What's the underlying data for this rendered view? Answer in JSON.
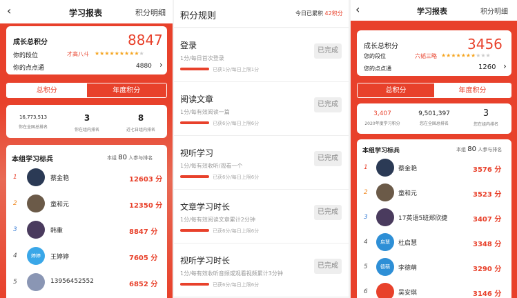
{
  "left": {
    "title": "学习报表",
    "right_link": "积分明细",
    "total_label": "成长总积分",
    "total_value": "8847",
    "rank_label": "你的段位",
    "rank_value": "才高八斗",
    "stars_on": 9,
    "stars_total": 10,
    "points_label": "你的点点通",
    "points_value": "4880",
    "tabs": [
      "总积分",
      "年度积分"
    ],
    "stats": [
      {
        "value": "16,773,513",
        "label": "你在全国总排名"
      },
      {
        "value": "3",
        "label": "你在组内排名"
      },
      {
        "value": "8",
        "label": "近七日组内排名"
      }
    ],
    "group_title": "本组学习标兵",
    "group_meta_prefix": "本组",
    "group_meta_count": "80",
    "group_meta_suffix": "人参与排名",
    "ranking": [
      {
        "rank": "1",
        "name": "蔡金艳",
        "score": "12603 分",
        "avatar_color": "#2b3a55",
        "avatar_text": ""
      },
      {
        "rank": "2",
        "name": "童和元",
        "score": "12350 分",
        "avatar_color": "#6b5a48",
        "avatar_text": ""
      },
      {
        "rank": "3",
        "name": "韩重",
        "score": "8847 分",
        "avatar_color": "#4a3b5e",
        "avatar_text": ""
      },
      {
        "rank": "4",
        "name": "王婷婷",
        "score": "7605 分",
        "avatar_color": "#3aa7e8",
        "avatar_text": "婷婷"
      },
      {
        "rank": "5",
        "name": "13956452552",
        "score": "6852 分",
        "avatar_color": "#8a96b4",
        "avatar_text": ""
      }
    ]
  },
  "middle": {
    "title": "积分规则",
    "today_prefix": "今日已累积",
    "today_value": "42积分",
    "rules": [
      {
        "title": "登录",
        "desc": "1分/每日首次登录",
        "count": "已获1分/每日上限1分",
        "button": "已完成"
      },
      {
        "title": "阅读文章",
        "desc": "1分/每有效阅读一篇",
        "count": "已获6分/每日上限6分",
        "button": "已完成"
      },
      {
        "title": "视听学习",
        "desc": "1分/每有效收听/观看一个",
        "count": "已获6分/每日上限6分",
        "button": "已完成"
      },
      {
        "title": "文章学习时长",
        "desc": "1分/每有效阅读文章累计2分钟",
        "count": "已获6分/每日上限6分",
        "button": "已完成"
      },
      {
        "title": "视听学习时长",
        "desc": "1分/每有效收听音频或观看视频累计3分钟",
        "count": "已获6分/每日上限6分",
        "button": "已完成"
      }
    ]
  },
  "right": {
    "title": "学习报表",
    "right_link": "积分明细",
    "total_label": "成长总积分",
    "total_value": "3456",
    "rank_label": "您的段位",
    "rank_value": "六韬三略",
    "stars_on": 7,
    "stars_total": 10,
    "points_label": "您的点点通",
    "points_value": "1260",
    "tabs": [
      "总积分",
      "年度积分"
    ],
    "stats": [
      {
        "value": "3,407",
        "label": "2020年度学习积分"
      },
      {
        "value": "9,501,397",
        "label": "您在全国总排名"
      },
      {
        "value": "3",
        "label": "您在组内排名"
      }
    ],
    "group_title": "本组学习标兵",
    "group_meta_prefix": "本组",
    "group_meta_count": "80",
    "group_meta_suffix": "人参与排名",
    "ranking": [
      {
        "rank": "1",
        "name": "蔡金艳",
        "score": "3576 分",
        "avatar_color": "#2b3a55",
        "avatar_text": ""
      },
      {
        "rank": "2",
        "name": "童和元",
        "score": "3523 分",
        "avatar_color": "#6b5a48",
        "avatar_text": ""
      },
      {
        "rank": "3",
        "name": "17英语5班郑欣捷",
        "score": "3407 分",
        "avatar_color": "#4a3b5e",
        "avatar_text": ""
      },
      {
        "rank": "4",
        "name": "杜启慧",
        "score": "3348 分",
        "avatar_color": "#2e8fd6",
        "avatar_text": "启慧"
      },
      {
        "rank": "5",
        "name": "李德萌",
        "score": "3290 分",
        "avatar_color": "#2e8fd6",
        "avatar_text": "德萌"
      },
      {
        "rank": "6",
        "name": "吴安琪",
        "score": "3146 分",
        "avatar_color": "#e8412b",
        "avatar_text": ""
      }
    ]
  }
}
